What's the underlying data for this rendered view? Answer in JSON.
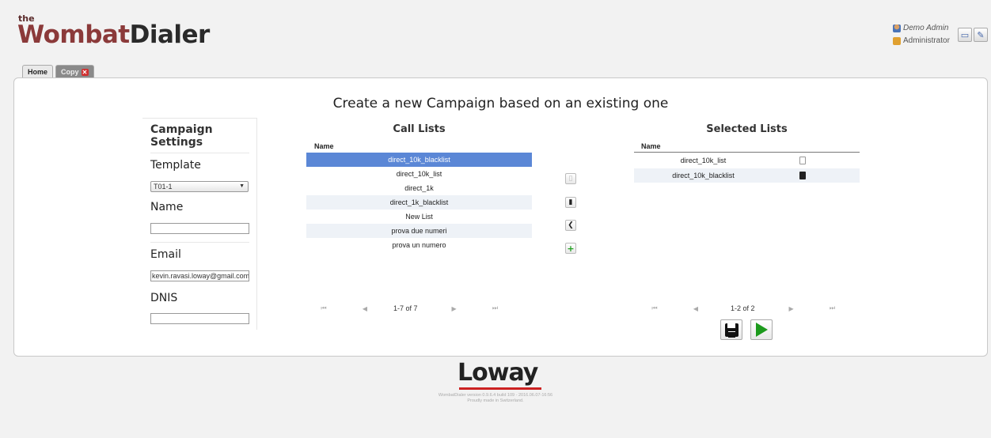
{
  "logo": {
    "the": "the",
    "part1": "Wombat",
    "part2": "Dialer"
  },
  "user": {
    "name": "Demo Admin",
    "role": "Administrator"
  },
  "tabs": [
    {
      "label": "Home"
    },
    {
      "label": "Copy"
    }
  ],
  "page_title": "Create a new Campaign based on an existing one",
  "settings": {
    "title": "Campaign Settings",
    "template_label": "Template",
    "template_value": "T01-1",
    "name_label": "Name",
    "name_value": "",
    "email_label": "Email",
    "email_value": "kevin.ravasi.loway@gmail.com",
    "dnis_label": "DNIS",
    "dnis_value": ""
  },
  "call_lists": {
    "title": "Call Lists",
    "header": "Name",
    "rows": [
      "direct_10k_blacklist",
      "direct_10k_list",
      "direct_1k",
      "direct_1k_blacklist",
      "New List",
      "prova due numeri",
      "prova un numero"
    ],
    "selected_index": 0,
    "pager": "1-7 of 7"
  },
  "selected_lists": {
    "title": "Selected Lists",
    "header": "Name",
    "rows": [
      "direct_10k_list",
      "direct_10k_blacklist"
    ],
    "pager": "1-2 of 2"
  },
  "icons": {
    "save": "floppy-disk-icon",
    "start": "play-icon",
    "add_row": "plus-icon",
    "move_left": "chevron-left-icon",
    "doc": "document-icon"
  },
  "colors": {
    "selected_row": "#5b87d6",
    "accent_green": "#1c9a1c",
    "logo_red": "#8b3a3a"
  },
  "footer": {
    "brand": "Loway",
    "version": "WombatDialer version 0.9.6.4 build 109 - 2016.06.07-16:56",
    "tagline": "Proudly made in Switzerland."
  }
}
